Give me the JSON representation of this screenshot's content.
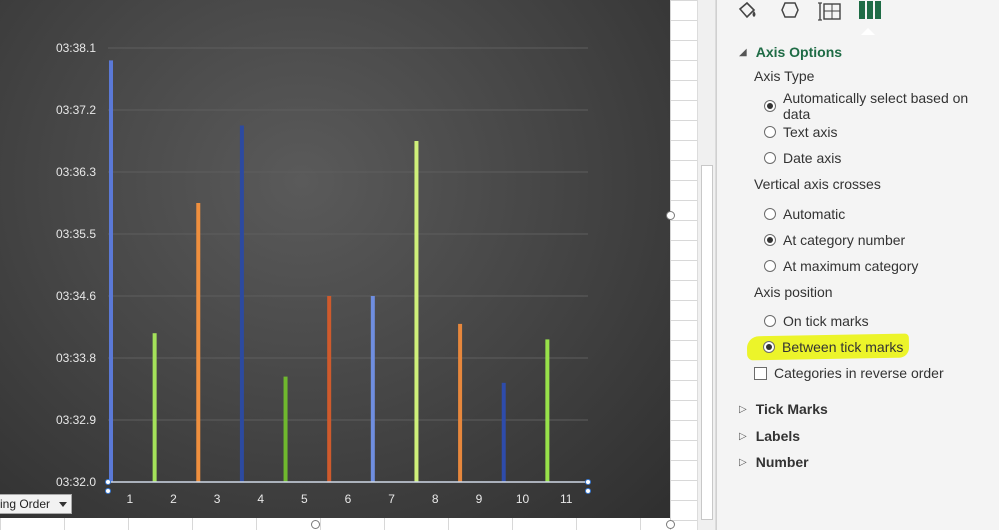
{
  "chart": {
    "field_button_label": "ing  Order",
    "chart_data": {
      "type": "bar",
      "categories": [
        "1",
        "2",
        "3",
        "4",
        "5",
        "6",
        "7",
        "8",
        "9",
        "10",
        "11"
      ],
      "y_tick_labels": [
        "03:32.0",
        "03:32.9",
        "03:33.8",
        "03:34.6",
        "03:35.5",
        "03:36.3",
        "03:37.2",
        "03:38.1"
      ],
      "ylim": [
        0,
        7
      ],
      "values": [
        6.8,
        2.4,
        4.5,
        5.75,
        1.7,
        3.0,
        3.0,
        5.5,
        2.55,
        1.6,
        2.3
      ],
      "grid": true,
      "legend": "none"
    },
    "bar_colors": [
      "#5b79d6",
      "#a4e25a",
      "#ef8f3e",
      "#2c4aa0",
      "#6fb82e",
      "#cf5a2c",
      "#6f8ee0",
      "#cff07a",
      "#e7873c",
      "#2e4cab",
      "#98e24a"
    ]
  },
  "pane": {
    "axis_options": {
      "title": "Axis Options",
      "axis_type_label": "Axis Type",
      "axis_type_options": [
        "Automatically select based on data",
        "Text axis",
        "Date axis"
      ],
      "vertical_crosses_label": "Vertical axis crosses",
      "vertical_crosses_options": [
        "Automatic",
        "At category number",
        "At maximum category"
      ],
      "axis_position_label": "Axis position",
      "axis_position_options": [
        "On tick marks",
        "Between tick marks"
      ],
      "reverse_order_label": "Categories in reverse order"
    },
    "sections": {
      "tick_marks": "Tick Marks",
      "labels": "Labels",
      "number": "Number"
    },
    "accent_color": "#1e6b45"
  }
}
